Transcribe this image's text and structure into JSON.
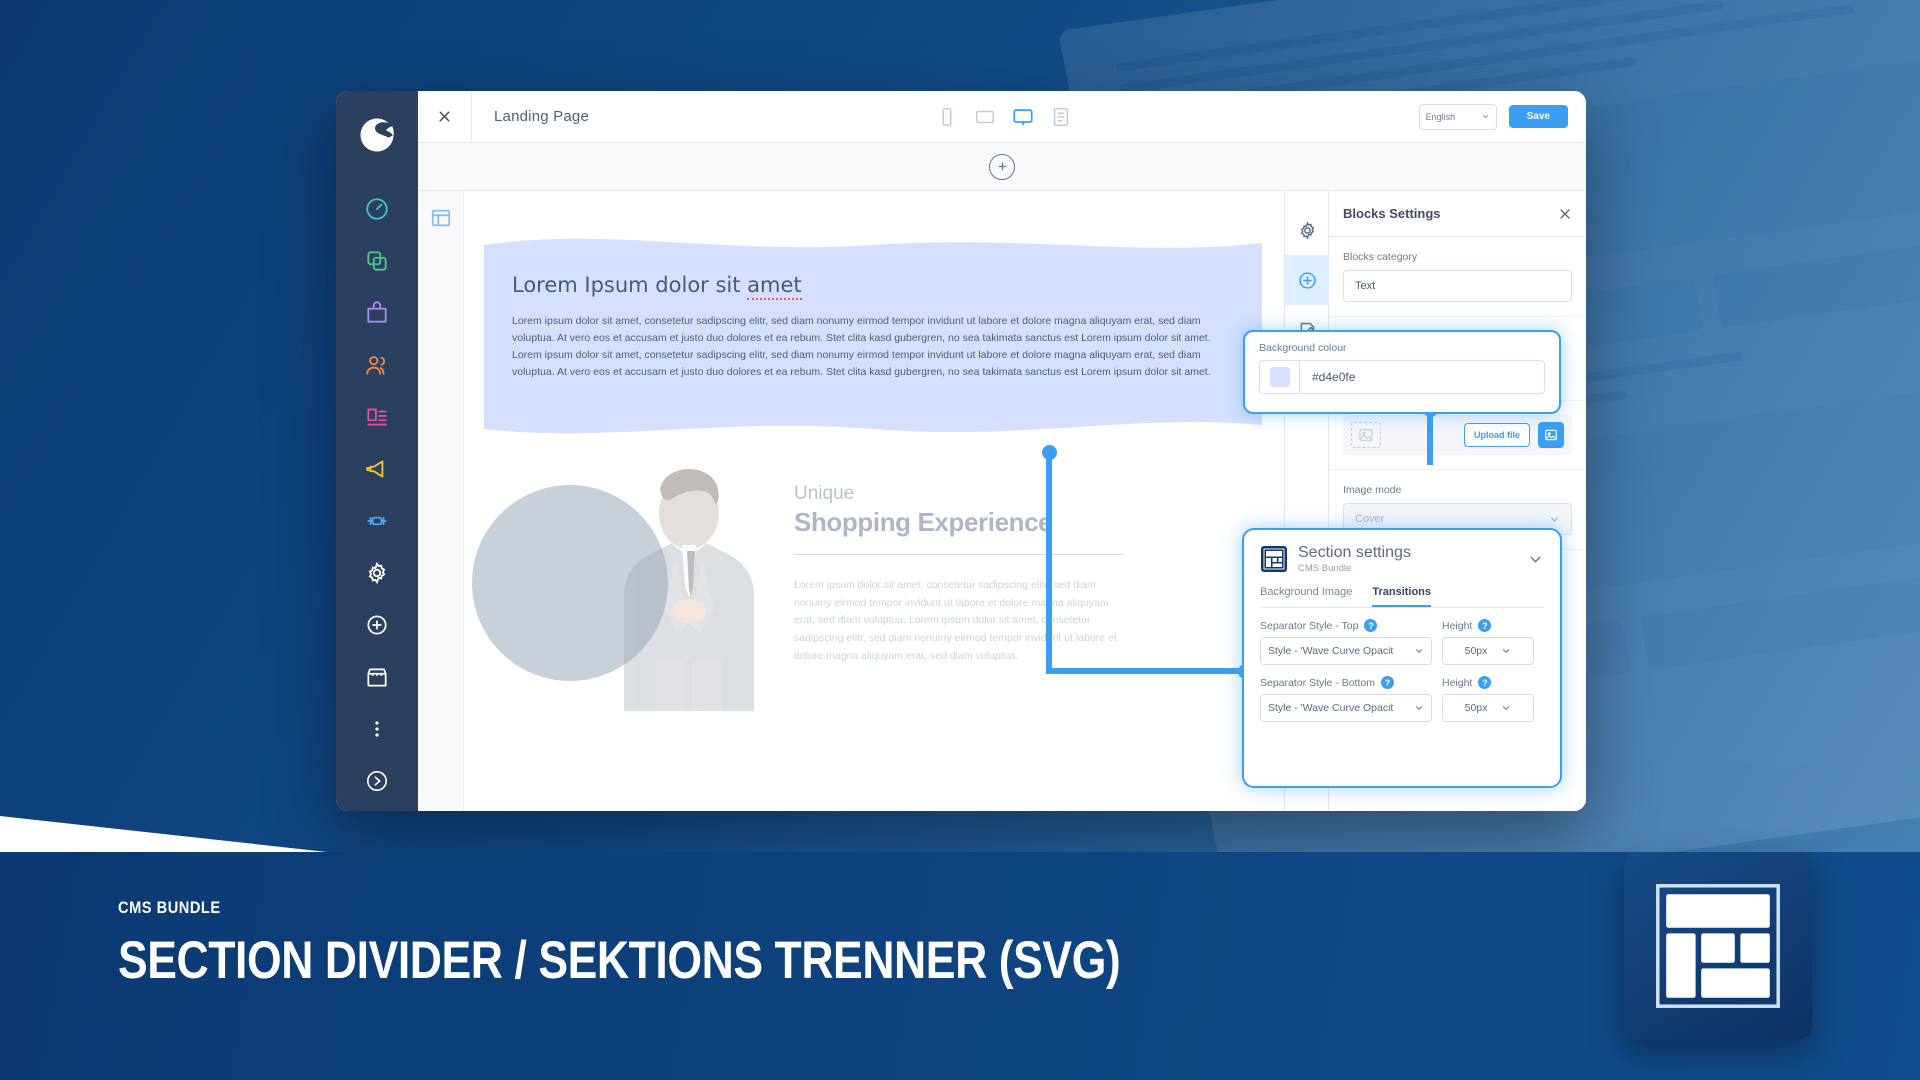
{
  "background": {
    "gradient_from": "#0b3a72",
    "gradient_to": "#4d84b5",
    "accent": "#3a9ef5"
  },
  "sidebar": {
    "brand": "shopware-logo",
    "items": [
      {
        "name": "dashboard",
        "icon": "gauge-icon",
        "color": "#3ec6d1"
      },
      {
        "name": "catalogues",
        "icon": "layers-icon",
        "color": "#4cc98a"
      },
      {
        "name": "orders",
        "icon": "bag-icon",
        "color": "#a78bf0"
      },
      {
        "name": "customers",
        "icon": "users-icon",
        "color": "#f08a4b"
      },
      {
        "name": "content",
        "icon": "content-icon",
        "color": "#e84f9b"
      },
      {
        "name": "marketing",
        "icon": "megaphone-icon",
        "color": "#f2c230"
      },
      {
        "name": "extensions",
        "icon": "plug-icon",
        "color": "#4da8f0"
      },
      {
        "name": "settings",
        "icon": "gear-icon",
        "color": "#ffffff"
      },
      {
        "name": "add",
        "icon": "plus-circle-icon",
        "color": "#ffffff"
      },
      {
        "name": "store",
        "icon": "store-icon",
        "color": "#ffffff"
      },
      {
        "name": "more",
        "icon": "more-vertical-icon",
        "color": "#ffffff"
      },
      {
        "name": "expand",
        "icon": "chevron-right-circle-icon",
        "color": "#ffffff"
      }
    ]
  },
  "topbar": {
    "close_label": "×",
    "page_name": "Landing Page",
    "devices": [
      {
        "name": "mobile",
        "icon": "mobile-icon",
        "active": false
      },
      {
        "name": "tablet",
        "icon": "tablet-icon",
        "active": false
      },
      {
        "name": "desktop",
        "icon": "desktop-icon",
        "active": true
      },
      {
        "name": "form",
        "icon": "form-icon",
        "active": false
      }
    ],
    "language": "English",
    "save_label": "Save"
  },
  "canvas": {
    "add_section_label": "+",
    "section_icon": "section-layout-icon",
    "hero": {
      "background_colour": "#d4e0fe",
      "heading_plain": "Lorem Ipsum dolor sit ",
      "heading_marked": "amet",
      "paragraph": "Lorem ipsum dolor sit amet, consetetur sadipscing elitr, sed diam nonumy eirmod tempor invidunt ut labore et dolore magna aliquyam erat, sed diam voluptua. At vero eos et accusam et justo duo dolores et ea rebum. Stet clita kasd gubergren, no sea takimata sanctus est Lorem ipsum dolor sit amet. Lorem ipsum dolor sit amet, consetetur sadipscing elitr, sed diam nonumy eirmod tempor invidunt ut labore et dolore magna aliquyam erat, sed diam voluptua. At vero eos et accusam et justo duo dolores et ea rebum. Stet clita kasd gubergren, no sea takimata sanctus est Lorem ipsum dolor sit amet."
    },
    "second_section": {
      "eyebrow": "Unique",
      "headline": "Shopping Experience",
      "paragraph": "Lorem ipsum dolor sit amet, consetetur sadipscing elitr, sed diam nonumy eirmod tempor invidunt ut labore et dolore magna aliquyam erat, sed diam voluptua. Lorem ipsum dolor sit amet, consetetur sadipscing elitr, sed diam nonumy eirmod tempor invidunt ut labore et dolore magna aliquyam erat, sed diam voluptua.",
      "image": "businessman-photo"
    }
  },
  "right_panel": {
    "rail": [
      {
        "name": "settings",
        "icon": "gear-icon",
        "active": false
      },
      {
        "name": "add-block",
        "icon": "plus-circle-icon",
        "active": true
      },
      {
        "name": "edit-block",
        "icon": "edit-document-icon",
        "active": false
      }
    ],
    "title": "Blocks Settings",
    "close_icon": "close-icon",
    "blocks_category_label": "Blocks category",
    "blocks_category_value": "Text",
    "upload_file_label": "Upload file",
    "media_picker_icon": "image-icon",
    "image_mode_label": "Image mode",
    "image_mode_value": "Cover"
  },
  "callouts": {
    "background_colour": {
      "label": "Background colour",
      "value": "#d4e0fe",
      "swatch": "#d4e0fe"
    },
    "section_settings": {
      "logo_icon": "cms-bundle-logo",
      "title": "Section settings",
      "subtitle": "CMS Bundle",
      "chevron_icon": "chevron-down-icon",
      "tabs": [
        {
          "label": "Background Image",
          "active": false
        },
        {
          "label": "Transitions",
          "active": true
        }
      ],
      "fields": [
        {
          "style_label": "Separator Style - Top",
          "style_value": "Style - 'Wave Curve Opacit",
          "height_label": "Height",
          "height_value": "50px",
          "help_icon": "help-icon"
        },
        {
          "style_label": "Separator Style - Bottom",
          "style_value": "Style - 'Wave Curve Opacit",
          "height_label": "Height",
          "height_value": "50px",
          "help_icon": "help-icon"
        }
      ]
    }
  },
  "banner": {
    "kicker": "CMS BUNDLE",
    "title": "SECTION DIVIDER / SEKTIONS TRENNER (SVG)",
    "badge_icon": "cms-layout-grid-icon"
  }
}
